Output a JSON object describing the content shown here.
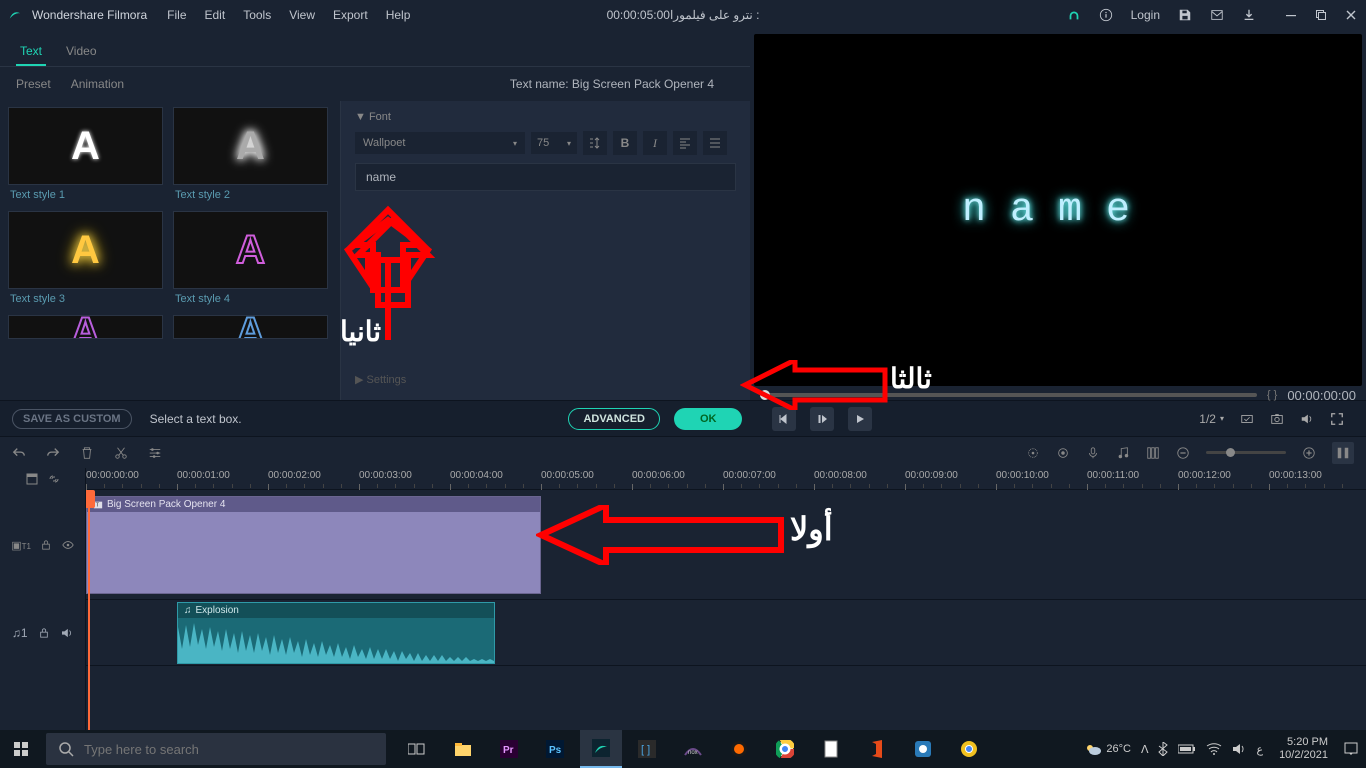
{
  "app": {
    "title": "Wondershare Filmora"
  },
  "menu": {
    "file": "File",
    "edit": "Edit",
    "tools": "Tools",
    "view": "View",
    "export": "Export",
    "help": "Help"
  },
  "titlebar": {
    "project": "00:00:05:00نترو على فيلمورا :",
    "login": "Login"
  },
  "tabs": {
    "text": "Text",
    "video": "Video"
  },
  "subtabs": {
    "preset": "Preset",
    "animation": "Animation"
  },
  "text_panel": {
    "name_label": "Text name: Big Screen Pack Opener 4",
    "font_section": "Font",
    "font_family": "Wallpoet",
    "font_size": "75",
    "text_value": "name",
    "settings": "Settings",
    "styles": {
      "s1": "Text style 1",
      "s2": "Text style 2",
      "s3": "Text style 3",
      "s4": "Text style 4"
    }
  },
  "preview": {
    "text": "name",
    "markers": "{      }",
    "time": "00:00:00:00",
    "ratio": "1/2"
  },
  "action": {
    "save_custom": "SAVE AS CUSTOM",
    "select": "Select a text box.",
    "advanced": "ADVANCED",
    "ok": "OK"
  },
  "timeline": {
    "ticks": [
      "00:00:00:00",
      "00:00:01:00",
      "00:00:02:00",
      "00:00:03:00",
      "00:00:04:00",
      "00:00:05:00",
      "00:00:06:00",
      "00:00:07:00",
      "00:00:08:00",
      "00:00:09:00",
      "00:00:10:00",
      "00:00:11:00",
      "00:00:12:00",
      "00:00:13:00"
    ],
    "video_clip": "Big Screen Pack Opener 4",
    "audio_clip": "Explosion",
    "track_video": "T1",
    "track_audio": "♫1"
  },
  "annotations": {
    "first": "أولا",
    "second": "ثانيا",
    "third": "ثالثا"
  },
  "taskbar": {
    "search_placeholder": "Type here to search",
    "weather": "26°C",
    "time": "5:20 PM",
    "date": "10/2/2021"
  }
}
